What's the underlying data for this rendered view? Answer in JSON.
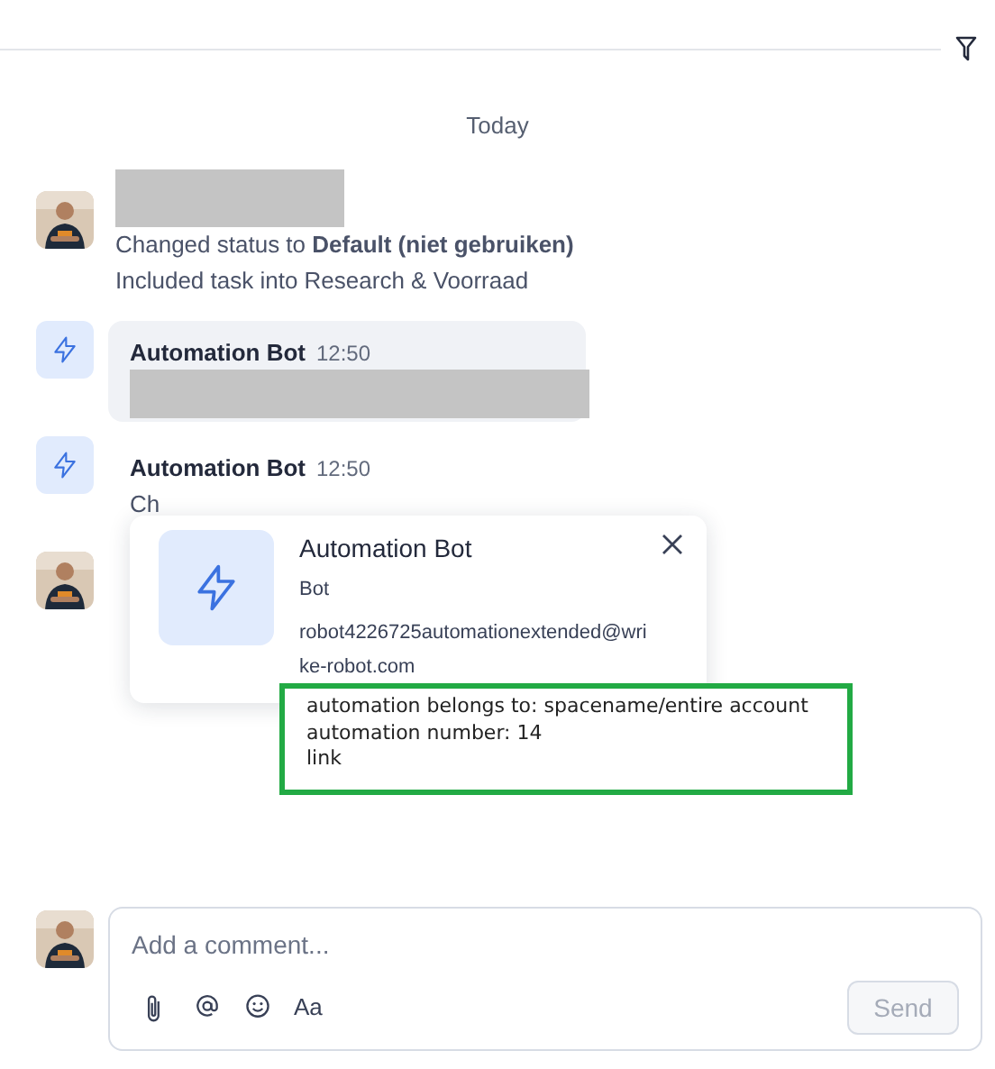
{
  "date_divider": "Today",
  "activity": [
    {
      "kind": "user",
      "redacted": true,
      "lines": [
        "Changed status to **Default (niet gebruiken)**",
        "Included task into Research & Voorraad"
      ]
    },
    {
      "kind": "bot",
      "author": "Automation Bot",
      "time": "12:50",
      "highlighted": true,
      "redacted": true
    },
    {
      "kind": "bot",
      "author": "Automation Bot",
      "time": "12:50",
      "lines": [
        "Ch"
      ]
    },
    {
      "kind": "user"
    }
  ],
  "popover": {
    "name": "Automation Bot",
    "role": "Bot",
    "email": "robot4226725automationextended@wrike-robot.com"
  },
  "annotation": {
    "lines": [
      "automation belongs to: spacename/entire account",
      "automation number: 14",
      "link"
    ]
  },
  "composer": {
    "placeholder": "Add a comment...",
    "format_label": "Aa",
    "send_label": "Send",
    "send_disabled": true
  }
}
